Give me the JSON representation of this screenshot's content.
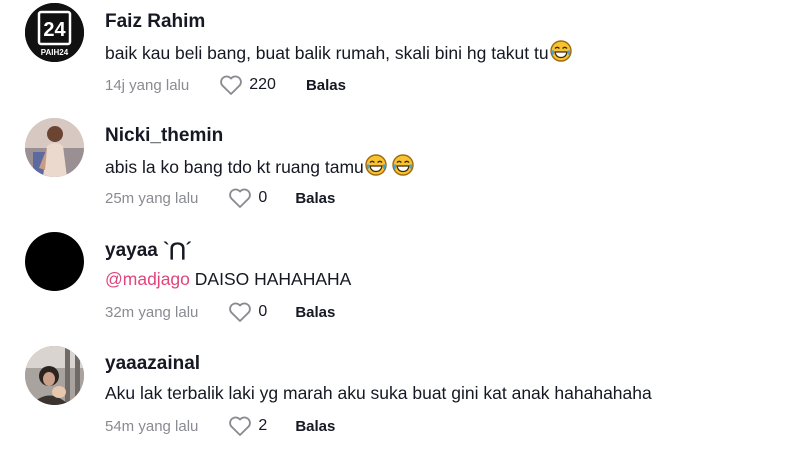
{
  "comments": [
    {
      "username": "Faiz Rahim",
      "avatar_text": "PAIH24",
      "text": "baik kau beli bang, buat balik rumah, skali bini hg takut tu",
      "emoji_count": 1,
      "time": "14j yang lalu",
      "likes": "220",
      "reply_label": "Balas"
    },
    {
      "username": "Nicki_themin",
      "text": "abis la ko bang tdo kt ruang tamu",
      "emoji_count": 2,
      "time": "25m yang lalu",
      "likes": "0",
      "reply_label": "Balas"
    },
    {
      "username": "yayaa `⋂´",
      "mention": "@madjago",
      "text": " DAISO HAHAHAHA",
      "emoji_count": 0,
      "time": "32m yang lalu",
      "likes": "0",
      "reply_label": "Balas"
    },
    {
      "username": "yaaazainal",
      "text": "Aku lak terbalik laki yg marah aku suka buat gini kat anak hahahahaha",
      "emoji_count": 0,
      "time": "54m yang lalu",
      "likes": "2",
      "reply_label": "Balas"
    }
  ],
  "colors": {
    "mention": "#e0457b",
    "muted": "#8a8b91",
    "text": "#161823"
  },
  "icons": [
    "heart-outline-icon",
    "joy-emoji-icon"
  ]
}
